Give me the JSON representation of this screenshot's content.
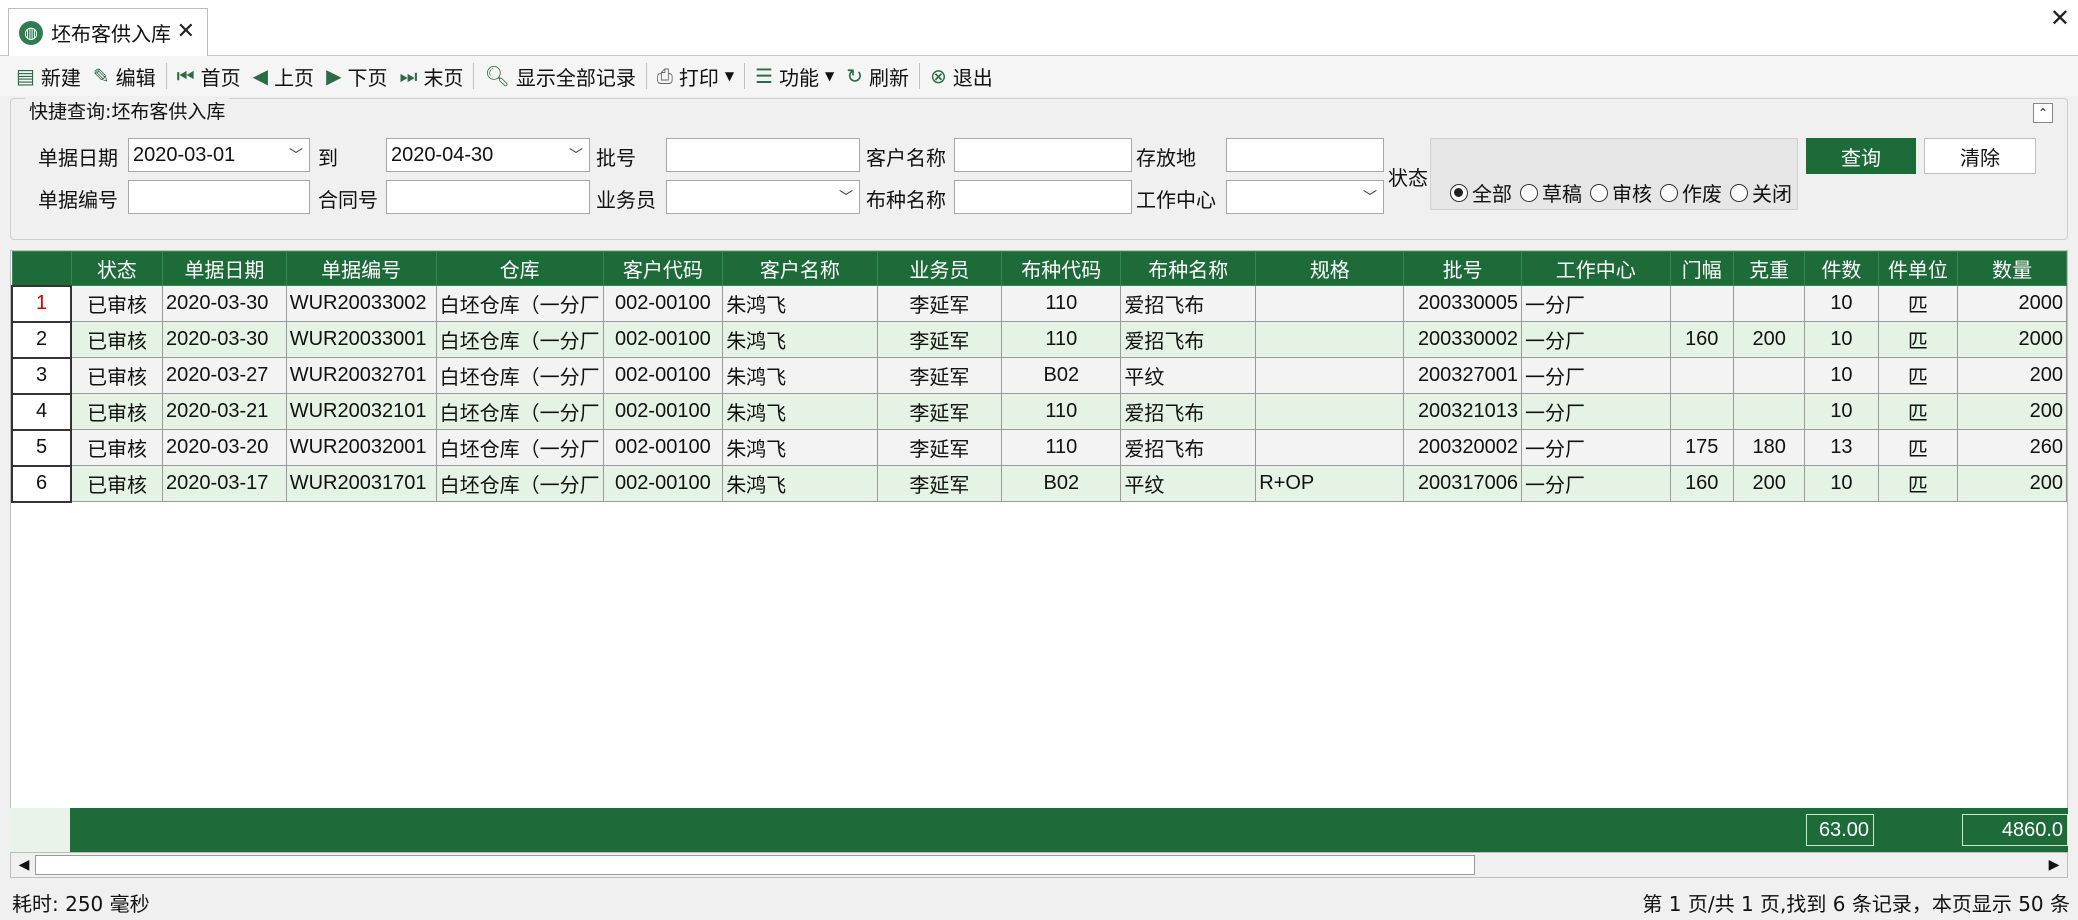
{
  "tab": {
    "title": "坯布客供入库",
    "icon": "globe-icon"
  },
  "toolbar": {
    "new": "新建",
    "edit": "编辑",
    "first": "首页",
    "prev": "上页",
    "next": "下页",
    "last": "末页",
    "show_all": "显示全部记录",
    "print": "打印",
    "function": "功能",
    "refresh": "刷新",
    "exit": "退出"
  },
  "query": {
    "title": "快捷查询:坯布客供入库",
    "date_label": "单据日期",
    "date_from": "2020-03-01",
    "to_label": "到",
    "date_to": "2020-04-30",
    "batch_label": "批号",
    "batch_value": "",
    "customer_label": "客户名称",
    "customer_value": "",
    "storage_label": "存放地",
    "storage_value": "",
    "status_label": "状态",
    "docno_label": "单据编号",
    "docno_value": "",
    "contract_label": "合同号",
    "contract_value": "",
    "salesman_label": "业务员",
    "salesman_value": "",
    "fabric_label": "布种名称",
    "fabric_value": "",
    "workcenter_label": "工作中心",
    "workcenter_value": "",
    "status_options": [
      "全部",
      "草稿",
      "审核",
      "作废",
      "关闭"
    ],
    "status_selected": "全部",
    "query_button": "查询",
    "clear_button": "清除"
  },
  "grid": {
    "columns": [
      "状态",
      "单据日期",
      "单据编号",
      "仓库",
      "客户代码",
      "客户名称",
      "业务员",
      "布种代码",
      "布种名称",
      "规格",
      "批号",
      "工作中心",
      "门幅",
      "克重",
      "件数",
      "件单位",
      "数量"
    ],
    "rows": [
      [
        "1",
        "已审核",
        "2020-03-30",
        "WUR20033002",
        "白坯仓库（一分厂",
        "002-00100",
        "朱鸿飞",
        "李延军",
        "110",
        "爱招飞布",
        "",
        "200330005",
        "一分厂",
        "",
        "",
        "10",
        "匹",
        "2000"
      ],
      [
        "2",
        "已审核",
        "2020-03-30",
        "WUR20033001",
        "白坯仓库（一分厂",
        "002-00100",
        "朱鸿飞",
        "李延军",
        "110",
        "爱招飞布",
        "",
        "200330002",
        "一分厂",
        "160",
        "200",
        "10",
        "匹",
        "2000"
      ],
      [
        "3",
        "已审核",
        "2020-03-27",
        "WUR20032701",
        "白坯仓库（一分厂",
        "002-00100",
        "朱鸿飞",
        "李延军",
        "B02",
        "平纹",
        "",
        "200327001",
        "一分厂",
        "",
        "",
        "10",
        "匹",
        "200"
      ],
      [
        "4",
        "已审核",
        "2020-03-21",
        "WUR20032101",
        "白坯仓库（一分厂",
        "002-00100",
        "朱鸿飞",
        "李延军",
        "110",
        "爱招飞布",
        "",
        "200321013",
        "一分厂",
        "",
        "",
        "10",
        "匹",
        "200"
      ],
      [
        "5",
        "已审核",
        "2020-03-20",
        "WUR20032001",
        "白坯仓库（一分厂",
        "002-00100",
        "朱鸿飞",
        "李延军",
        "110",
        "爱招飞布",
        "",
        "200320002",
        "一分厂",
        "175",
        "180",
        "13",
        "匹",
        "260"
      ],
      [
        "6",
        "已审核",
        "2020-03-17",
        "WUR20031701",
        "白坯仓库（一分厂",
        "002-00100",
        "朱鸿飞",
        "李延军",
        "B02",
        "平纹",
        "R+OP",
        "200317006",
        "一分厂",
        "160",
        "200",
        "10",
        "匹",
        "200"
      ]
    ],
    "total_pieces": "63.00",
    "total_quantity": "4860.0"
  },
  "status": {
    "elapsed": "耗时: 250 毫秒",
    "paging": "第 1 页/共 1 页,找到 6 条记录，本页显示 50 条"
  },
  "colors": {
    "accent": "#1e6b3a",
    "row_alt": "#e4f3e4"
  }
}
